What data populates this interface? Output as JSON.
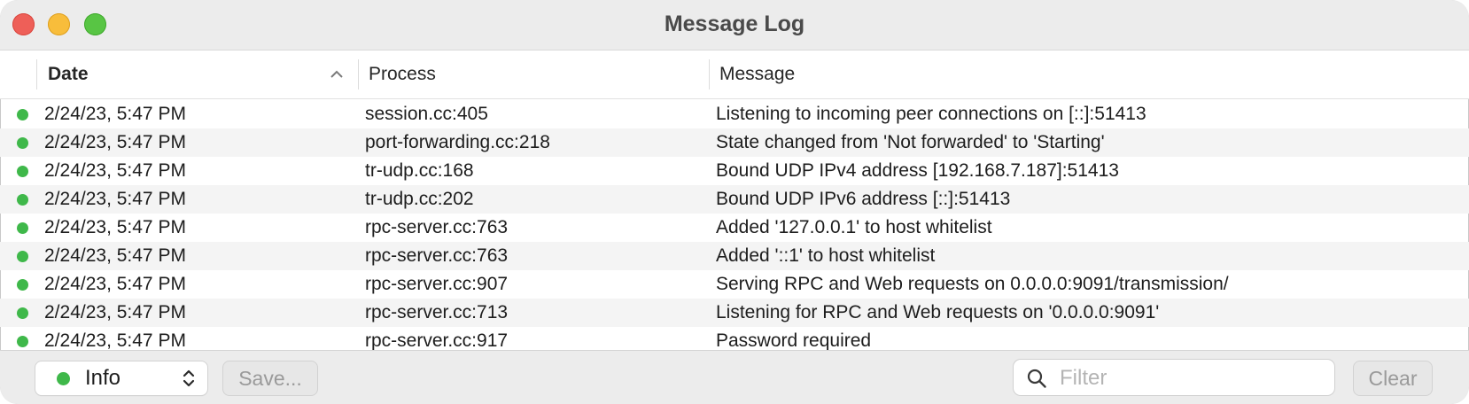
{
  "window": {
    "title": "Message Log"
  },
  "columns": {
    "date": "Date",
    "process": "Process",
    "message": "Message"
  },
  "colors": {
    "status_info": "#3fb84a"
  },
  "rows": [
    {
      "date": "2/24/23, 5:47 PM",
      "process": "session.cc:405",
      "message": "Listening to incoming peer connections on [::]:51413"
    },
    {
      "date": "2/24/23, 5:47 PM",
      "process": "port-forwarding.cc:218",
      "message": "State changed from 'Not forwarded' to 'Starting'"
    },
    {
      "date": "2/24/23, 5:47 PM",
      "process": "tr-udp.cc:168",
      "message": "Bound UDP IPv4 address [192.168.7.187]:51413"
    },
    {
      "date": "2/24/23, 5:47 PM",
      "process": "tr-udp.cc:202",
      "message": "Bound UDP IPv6 address [::]:51413"
    },
    {
      "date": "2/24/23, 5:47 PM",
      "process": "rpc-server.cc:763",
      "message": "Added '127.0.0.1' to host whitelist"
    },
    {
      "date": "2/24/23, 5:47 PM",
      "process": "rpc-server.cc:763",
      "message": "Added '::1' to host whitelist"
    },
    {
      "date": "2/24/23, 5:47 PM",
      "process": "rpc-server.cc:907",
      "message": "Serving RPC and Web requests on 0.0.0.0:9091/transmission/"
    },
    {
      "date": "2/24/23, 5:47 PM",
      "process": "rpc-server.cc:713",
      "message": "Listening for RPC and Web requests on '0.0.0.0:9091'"
    },
    {
      "date": "2/24/23, 5:47 PM",
      "process": "rpc-server.cc:917",
      "message": "Password required"
    }
  ],
  "footer": {
    "level_selected": "Info",
    "save_label": "Save...",
    "filter_placeholder": "Filter",
    "filter_value": "",
    "clear_label": "Clear"
  }
}
